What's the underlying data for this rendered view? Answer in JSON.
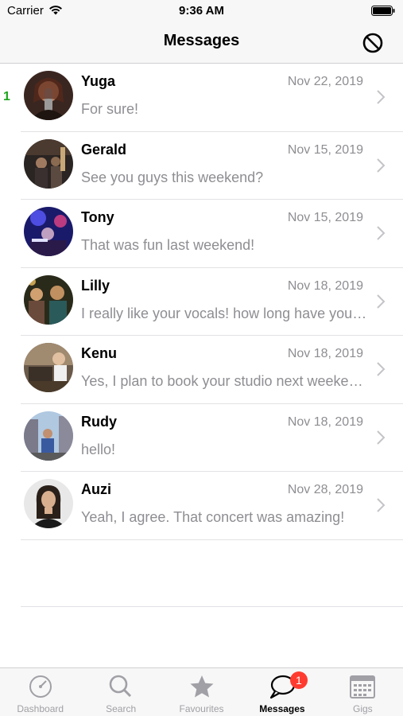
{
  "status_bar": {
    "carrier": "Carrier",
    "time": "9:36 AM",
    "wifi_icon": "wifi-icon",
    "battery_icon": "battery-icon"
  },
  "nav": {
    "title": "Messages",
    "block_icon": "block-icon"
  },
  "conversations": [
    {
      "name": "Yuga",
      "date": "Nov 22, 2019",
      "preview": "For sure!",
      "unread": "1"
    },
    {
      "name": "Gerald",
      "date": "Nov 15, 2019",
      "preview": "See you guys this weekend?"
    },
    {
      "name": "Tony",
      "date": "Nov 15, 2019",
      "preview": "That was fun last weekend!"
    },
    {
      "name": "Lilly",
      "date": "Nov 18, 2019",
      "preview": "I really like your vocals! how long have you been singing?"
    },
    {
      "name": "Kenu",
      "date": "Nov 18, 2019",
      "preview": "Yes, I plan to book your studio next weekend."
    },
    {
      "name": "Rudy",
      "date": "Nov 18, 2019",
      "preview": "hello!"
    },
    {
      "name": "Auzi",
      "date": "Nov 28, 2019",
      "preview": "Yeah, I agree. That concert was amazing!"
    }
  ],
  "tabs": [
    {
      "label": "Dashboard",
      "icon": "dashboard-icon"
    },
    {
      "label": "Search",
      "icon": "search-icon"
    },
    {
      "label": "Favourites",
      "icon": "star-icon"
    },
    {
      "label": "Messages",
      "icon": "chat-bubble-icon",
      "badge": "1",
      "active": true
    },
    {
      "label": "Gigs",
      "icon": "calendar-icon"
    }
  ],
  "colors": {
    "accent_active": "#000000",
    "inactive": "#a0a0a6",
    "badge": "#ff3b30",
    "unread": "#1ca51c",
    "secondary_text": "#8e8e93"
  }
}
